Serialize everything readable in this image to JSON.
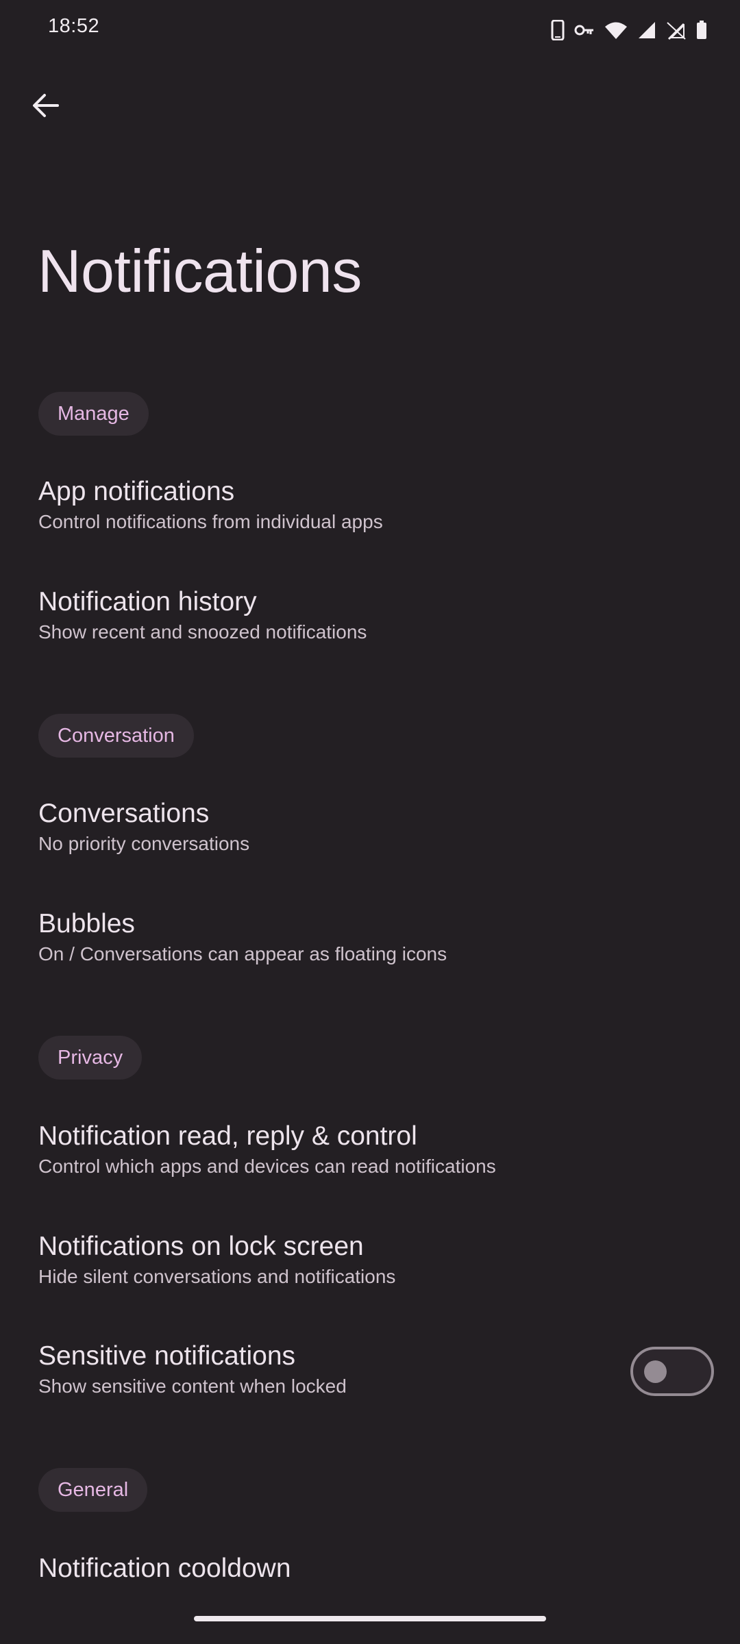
{
  "status_bar": {
    "time": "18:52",
    "icons": [
      "phone-icon",
      "vpn-key-icon",
      "wifi-icon",
      "signal-icon",
      "no-data-icon",
      "battery-icon"
    ]
  },
  "header": {
    "back_icon": "arrow-left-icon",
    "title": "Notifications"
  },
  "sections": {
    "manage": {
      "label": "Manage",
      "items": [
        {
          "title": "App notifications",
          "summary": "Control notifications from individual apps"
        },
        {
          "title": "Notification history",
          "summary": "Show recent and snoozed notifications"
        }
      ]
    },
    "conversation": {
      "label": "Conversation",
      "items": [
        {
          "title": "Conversations",
          "summary": "No priority conversations"
        },
        {
          "title": "Bubbles",
          "summary": "On / Conversations can appear as floating icons"
        }
      ]
    },
    "privacy": {
      "label": "Privacy",
      "items": [
        {
          "title": "Notification read, reply & control",
          "summary": "Control which apps and devices can read notifications"
        },
        {
          "title": "Notifications on lock screen",
          "summary": "Hide silent conversations and notifications"
        },
        {
          "title": "Sensitive notifications",
          "summary": "Show sensitive content when locked",
          "toggle_on": false
        }
      ]
    },
    "general": {
      "label": "General",
      "items": [
        {
          "title": "Notification cooldown"
        }
      ]
    }
  },
  "colors": {
    "background": "#231f23",
    "chip_background": "#322c32",
    "chip_text": "#e6b8e4",
    "title_text": "#ede4ec",
    "summary_text": "#cfc3cd",
    "toggle_off": "#948b93"
  }
}
